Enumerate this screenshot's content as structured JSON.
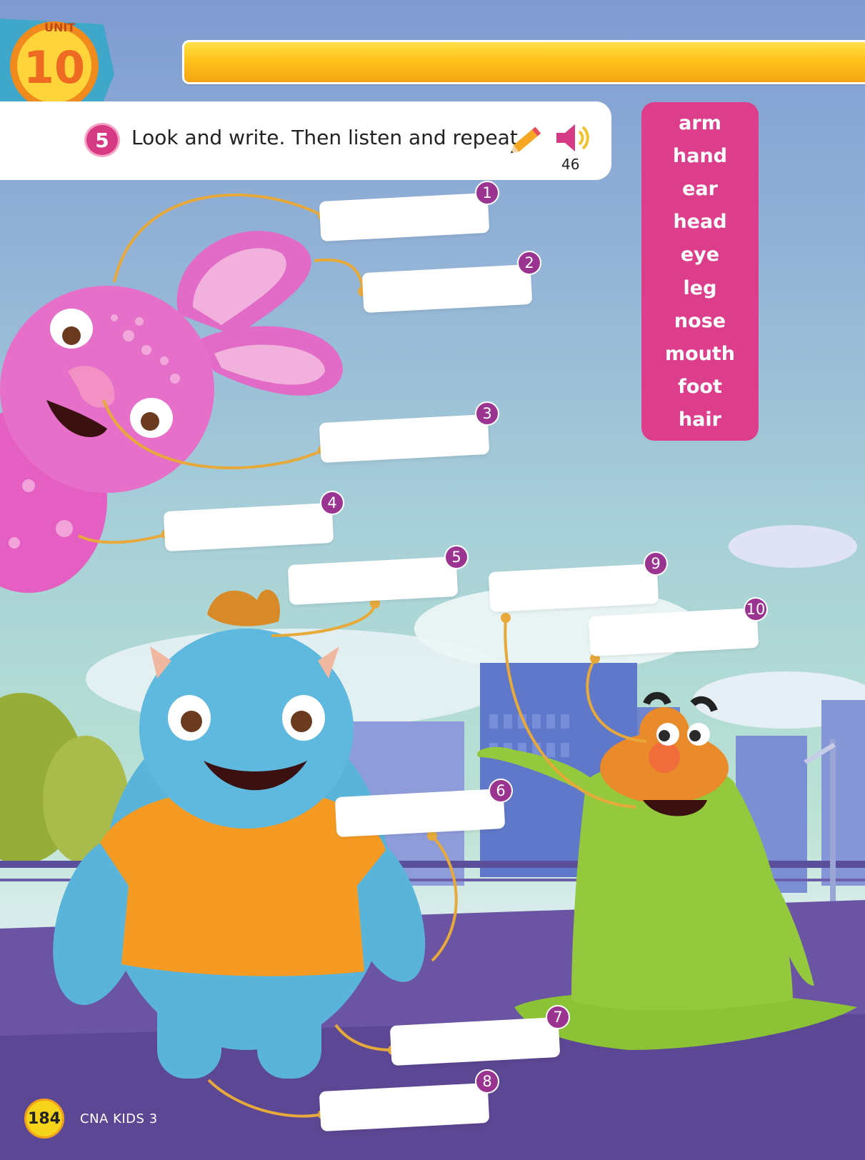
{
  "unit": {
    "label": "UNIT",
    "number": "10"
  },
  "exercise": {
    "number": "5",
    "instruction": "Look and write. Then listen and repeat.",
    "track": "46"
  },
  "word_bank": [
    "arm",
    "hand",
    "ear",
    "head",
    "eye",
    "leg",
    "nose",
    "mouth",
    "foot",
    "hair"
  ],
  "answer_labels": [
    "1",
    "2",
    "3",
    "4",
    "5",
    "6",
    "7",
    "8",
    "9",
    "10"
  ],
  "answers": [
    "",
    "",
    "",
    "",
    "",
    "",
    "",
    "",
    "",
    ""
  ],
  "footer": {
    "page_number": "184",
    "book_title": "CNA KIDS 3"
  },
  "colors": {
    "accent": "#dd3e8c",
    "badge": "#9b3391",
    "arrow": "#e7a93a",
    "header_bar": "#ffc21a"
  },
  "icons": [
    "pencil-icon",
    "speaker-icon"
  ]
}
